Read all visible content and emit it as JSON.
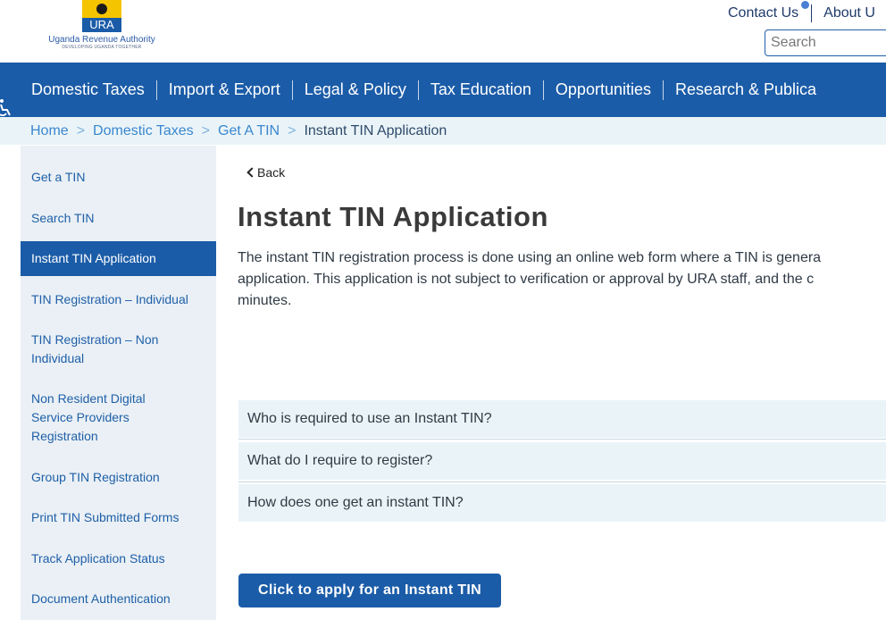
{
  "header": {
    "logo_text": "URA",
    "logo_name": "Uganda Revenue Authority",
    "logo_tagline": "DEVELOPING UGANDA TOGETHER",
    "contact_label": "Contact Us",
    "about_label": "About U",
    "search_placeholder": "Search"
  },
  "nav": {
    "items": [
      {
        "label": "Domestic Taxes"
      },
      {
        "label": "Import & Export"
      },
      {
        "label": "Legal & Policy"
      },
      {
        "label": "Tax Education"
      },
      {
        "label": "Opportunities"
      },
      {
        "label": "Research & Publica"
      }
    ]
  },
  "breadcrumb": {
    "items": [
      "Home",
      "Domestic Taxes",
      "Get A TIN"
    ],
    "current": "Instant TIN Application"
  },
  "sidebar": {
    "items": [
      {
        "label": "Get a TIN"
      },
      {
        "label": "Search TIN"
      },
      {
        "label": "Instant TIN Application"
      },
      {
        "label": "TIN Registration – Individual"
      },
      {
        "label": "TIN Registration – Non Individual"
      },
      {
        "label": "Non Resident Digital Service Providers Registration"
      },
      {
        "label": "Group TIN Registration"
      },
      {
        "label": "Print TIN Submitted Forms"
      },
      {
        "label": "Track Application Status"
      },
      {
        "label": "Document Authentication"
      }
    ]
  },
  "main": {
    "back_label": "Back",
    "title": "Instant TIN Application",
    "intro_lines": [
      "The instant TIN registration process is done using an online web form where a TIN is genera",
      "application. This application is not subject to verification or approval by URA staff, and the c",
      "minutes."
    ],
    "faqs": [
      {
        "question": "Who is required to use an Instant TIN?"
      },
      {
        "question": "What do I require to register?"
      },
      {
        "question": "How does one get an instant TIN?"
      }
    ],
    "apply_label": "Click to apply for an Instant TIN"
  },
  "colors": {
    "brand_blue": "#1b5ca8",
    "logo_yellow": "#f5c400",
    "light_panel": "#eaf4f8"
  }
}
